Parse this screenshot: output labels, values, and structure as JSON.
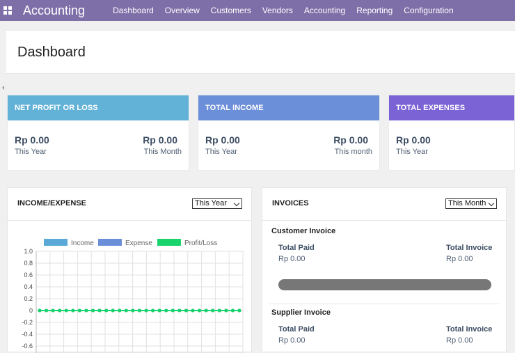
{
  "app": {
    "title": "Accounting"
  },
  "nav": [
    "Dashboard",
    "Overview",
    "Customers",
    "Vendors",
    "Accounting",
    "Reporting",
    "Configuration"
  ],
  "page": {
    "title": "Dashboard"
  },
  "kpis": [
    {
      "title": "NET PROFIT OR LOSS",
      "color": "#62b2d8",
      "left_value": "Rp 0.00",
      "left_label": "This Year",
      "right_value": "Rp 0.00",
      "right_label": "This Month"
    },
    {
      "title": "TOTAL INCOME",
      "color": "#6c8fd9",
      "left_value": "Rp 0.00",
      "left_label": "This Year",
      "right_value": "Rp 0.00",
      "right_label": "This month"
    },
    {
      "title": "TOTAL EXPENSES",
      "color": "#7b63d6",
      "left_value": "Rp 0.00",
      "left_label": "This Year"
    }
  ],
  "income_expense": {
    "title": "INCOME/EXPENSE",
    "filter": "This Year"
  },
  "invoices": {
    "title": "INVOICES",
    "filter": "This Month",
    "customer": {
      "heading": "Customer Invoice",
      "paid_label": "Total Paid",
      "paid_value": "Rp 0.00",
      "total_label": "Total Invoice",
      "total_value": "Rp 0.00",
      "paid_fraction": 0
    },
    "supplier": {
      "heading": "Supplier Invoice",
      "paid_label": "Total Paid",
      "paid_value": "Rp 0.00",
      "total_label": "Total Invoice",
      "total_value": "Rp 0.00"
    }
  },
  "chart_data": {
    "type": "line",
    "series": [
      {
        "name": "Income",
        "color": "#5aa9d6",
        "values": [
          0,
          0,
          0,
          0,
          0,
          0,
          0,
          0,
          0,
          0,
          0,
          0,
          0,
          0,
          0,
          0,
          0,
          0,
          0,
          0,
          0,
          0,
          0,
          0,
          0,
          0,
          0,
          0,
          0,
          0,
          0
        ]
      },
      {
        "name": "Expense",
        "color": "#6a8fd8",
        "values": [
          0,
          0,
          0,
          0,
          0,
          0,
          0,
          0,
          0,
          0,
          0,
          0,
          0,
          0,
          0,
          0,
          0,
          0,
          0,
          0,
          0,
          0,
          0,
          0,
          0,
          0,
          0,
          0,
          0,
          0,
          0
        ]
      },
      {
        "name": "Profit/Loss",
        "color": "#19d36b",
        "values": [
          0,
          0,
          0,
          0,
          0,
          0,
          0,
          0,
          0,
          0,
          0,
          0,
          0,
          0,
          0,
          0,
          0,
          0,
          0,
          0,
          0,
          0,
          0,
          0,
          0,
          0,
          0,
          0,
          0,
          0,
          0
        ]
      }
    ],
    "yticks": [
      "1.0",
      "0.8",
      "0.6",
      "0.4",
      "0.2",
      "0",
      "-0.2",
      "-0.4",
      "-0.6"
    ],
    "ylim": [
      -0.6,
      1.0
    ],
    "grid": true,
    "legend": "top"
  }
}
